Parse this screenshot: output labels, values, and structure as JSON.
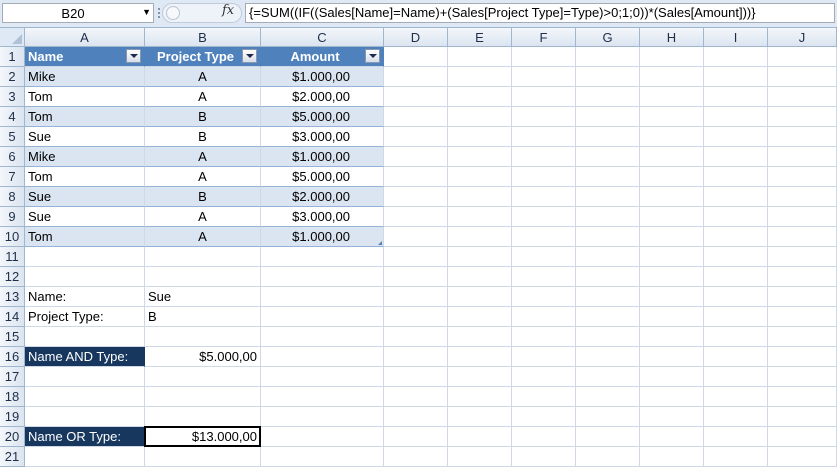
{
  "formula_bar": {
    "name_box": "B20",
    "fx_label": "fx",
    "formula": "{=SUM((IF((Sales[Name]=Name)+(Sales[Project Type]=Type)>0;1;0))*(Sales[Amount]))}"
  },
  "columns": [
    "A",
    "B",
    "C",
    "D",
    "E",
    "F",
    "G",
    "H",
    "I",
    "J"
  ],
  "rows": [
    "1",
    "2",
    "3",
    "4",
    "5",
    "6",
    "7",
    "8",
    "9",
    "10",
    "11",
    "12",
    "13",
    "14",
    "15",
    "16",
    "17",
    "18",
    "19",
    "20",
    "21"
  ],
  "table": {
    "headers": [
      "Name",
      "Project Type",
      "Amount"
    ],
    "rows": [
      [
        "Mike",
        "A",
        "$1.000,00"
      ],
      [
        "Tom",
        "A",
        "$2.000,00"
      ],
      [
        "Tom",
        "B",
        "$5.000,00"
      ],
      [
        "Sue",
        "B",
        "$3.000,00"
      ],
      [
        "Mike",
        "A",
        "$1.000,00"
      ],
      [
        "Tom",
        "A",
        "$5.000,00"
      ],
      [
        "Sue",
        "B",
        "$2.000,00"
      ],
      [
        "Sue",
        "A",
        "$3.000,00"
      ],
      [
        "Tom",
        "A",
        "$1.000,00"
      ]
    ],
    "style": {
      "header_color": "#4f81bd",
      "band_color": "#dbe5f1"
    }
  },
  "inputs": {
    "name_label": "Name:",
    "name_value": "Sue",
    "type_label": "Project Type:",
    "type_value": "B"
  },
  "results": {
    "and_label": "Name AND Type:",
    "and_value": "$5.000,00",
    "or_label": "Name OR Type:",
    "or_value": "$13.000,00",
    "label_color": "#17375e"
  }
}
